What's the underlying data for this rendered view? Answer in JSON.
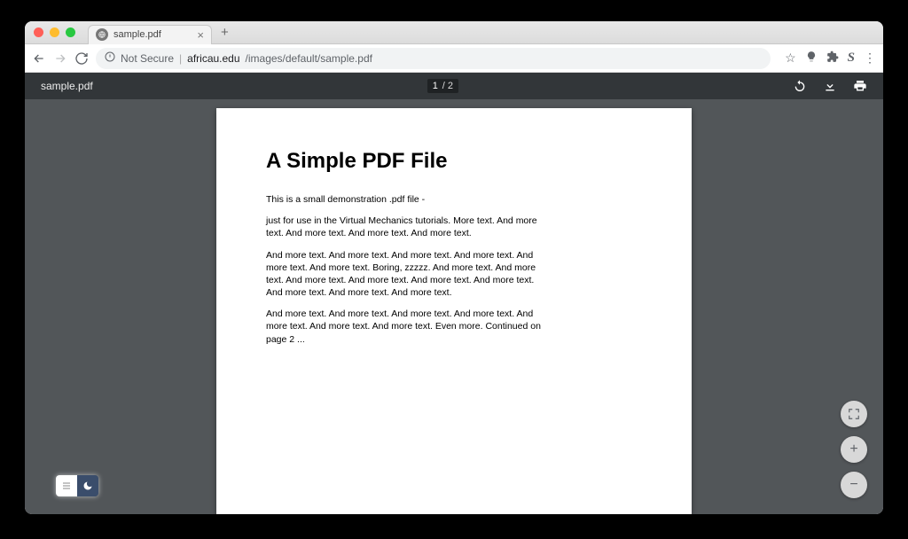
{
  "browser": {
    "tab": {
      "title": "sample.pdf"
    },
    "url_security_label": "Not Secure",
    "url_domain": "africau.edu",
    "url_path": "/images/default/sample.pdf"
  },
  "pdf_toolbar": {
    "filename": "sample.pdf",
    "current_page": "1",
    "page_sep_total": "/ 2"
  },
  "document": {
    "title": "A Simple PDF File",
    "p1": "This is a small demonstration .pdf file -",
    "p2": "just for use in the Virtual Mechanics tutorials. More text. And more text. And more text. And more text. And more text.",
    "p3": "And more text. And more text. And more text. And more text. And more text. And more text. Boring, zzzzz. And more text. And more text. And more text. And more text. And more text. And more text. And more text. And more text. And more text.",
    "p4": "And more text. And more text. And more text. And more text. And more text. And more text. And more text. Even more. Continued on page 2 ..."
  },
  "zoom": {
    "plus": "+",
    "minus": "−"
  }
}
